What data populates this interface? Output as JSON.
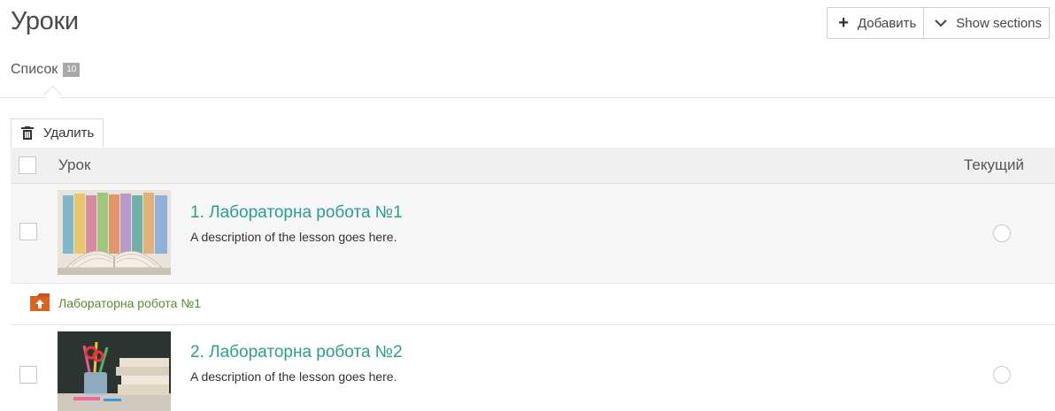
{
  "page": {
    "title": "Уроки"
  },
  "actions": {
    "add_label": "Добавить",
    "show_sections_label": "Show sections"
  },
  "tabs": [
    {
      "label": "Список",
      "count": "10"
    }
  ],
  "toolbar": {
    "delete_label": "Удалить"
  },
  "table": {
    "columns": [
      "Урок",
      "Текущий"
    ],
    "rows": [
      {
        "title": "1. Лабораторна робота №1",
        "description": "A description of the lesson goes here.",
        "thumbnail": "colorful-books-open-book-image",
        "current": false
      },
      {
        "title": "2. Лабораторна робота №2",
        "description": "A description of the lesson goes here.",
        "thumbnail": "pencils-and-books-chalkboard-image",
        "current": false
      }
    ],
    "section": {
      "label": "Лабораторна робота №1",
      "icon": "folder-upload-icon",
      "color": "#c8541d"
    }
  },
  "colors": {
    "link": "#2a9d8f",
    "section_link": "#5a8a2a",
    "header_bg": "#f0f0f0"
  }
}
